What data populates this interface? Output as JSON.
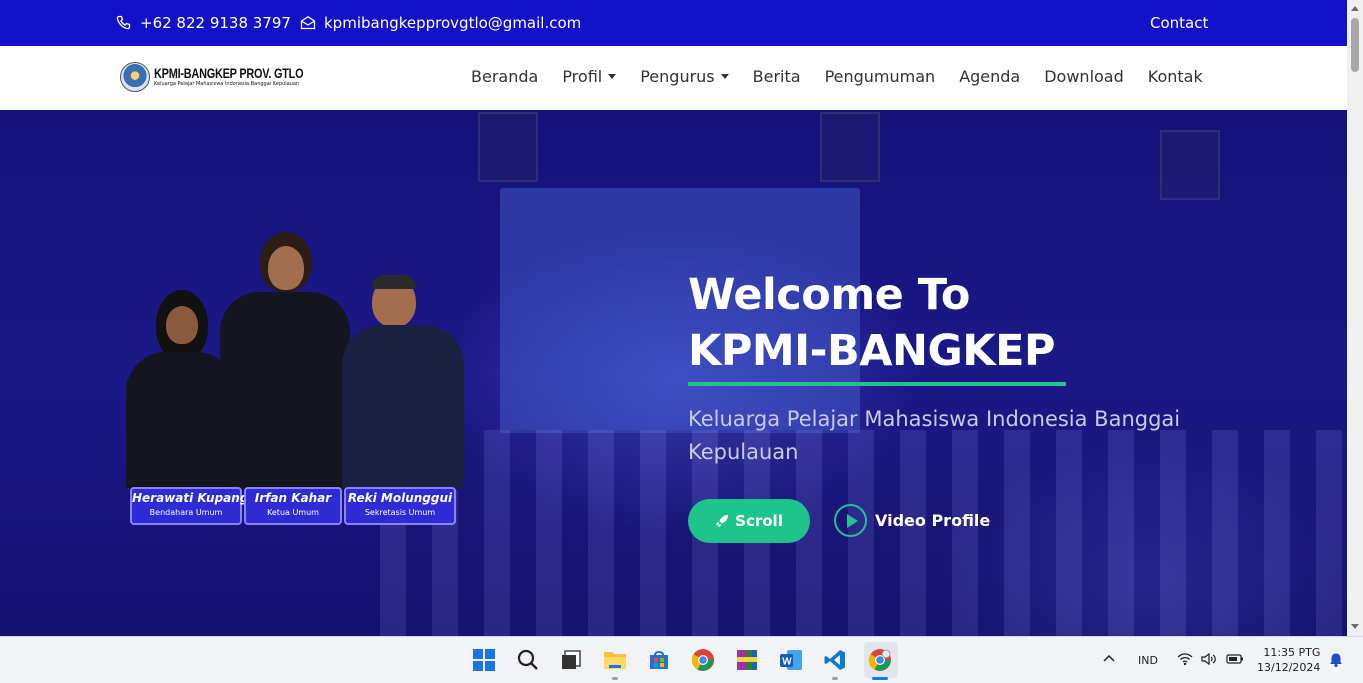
{
  "topbar": {
    "phone": "+62 822 9138 3797",
    "email": "kpmibangkepprovgtlo@gmail.com",
    "contact": "Contact",
    "bg_color": "#1212c9"
  },
  "brand": {
    "title": "KPMI-BANGKEP PROV. GTLO",
    "subtitle": "Keluarga Pelajar Mahasiswa Indonesia Banggai Kepulauan"
  },
  "nav": {
    "items": [
      {
        "label": "Beranda",
        "dropdown": false
      },
      {
        "label": "Profil",
        "dropdown": true
      },
      {
        "label": "Pengurus",
        "dropdown": true
      },
      {
        "label": "Berita",
        "dropdown": false
      },
      {
        "label": "Pengumuman",
        "dropdown": false
      },
      {
        "label": "Agenda",
        "dropdown": false
      },
      {
        "label": "Download",
        "dropdown": false
      },
      {
        "label": "Kontak",
        "dropdown": false
      }
    ]
  },
  "hero": {
    "headline_line1": "Welcome To",
    "headline_line2": "KPMI-BANGKEP",
    "subtitle": "Keluarga Pelajar Mahasiswa Indonesia Banggai Kepulauan",
    "scroll_button": "Scroll",
    "video_button": "Video Profile",
    "accent_color": "#1fc38c",
    "people": [
      {
        "name": "Herawati Kupang",
        "role": "Bendahara Umum"
      },
      {
        "name": "Irfan Kahar",
        "role": "Ketua Umum"
      },
      {
        "name": "Reki Molunggui",
        "role": "Sekretasis Umum"
      }
    ]
  },
  "taskbar": {
    "apps": [
      "start-icon",
      "search-icon",
      "task-view-icon",
      "file-explorer-icon",
      "store-icon",
      "chrome-icon",
      "winrar-icon",
      "word-icon",
      "vscode-icon",
      "chrome-active-icon"
    ],
    "language": "IND",
    "time": "11:35 PTG",
    "date": "13/12/2024"
  }
}
